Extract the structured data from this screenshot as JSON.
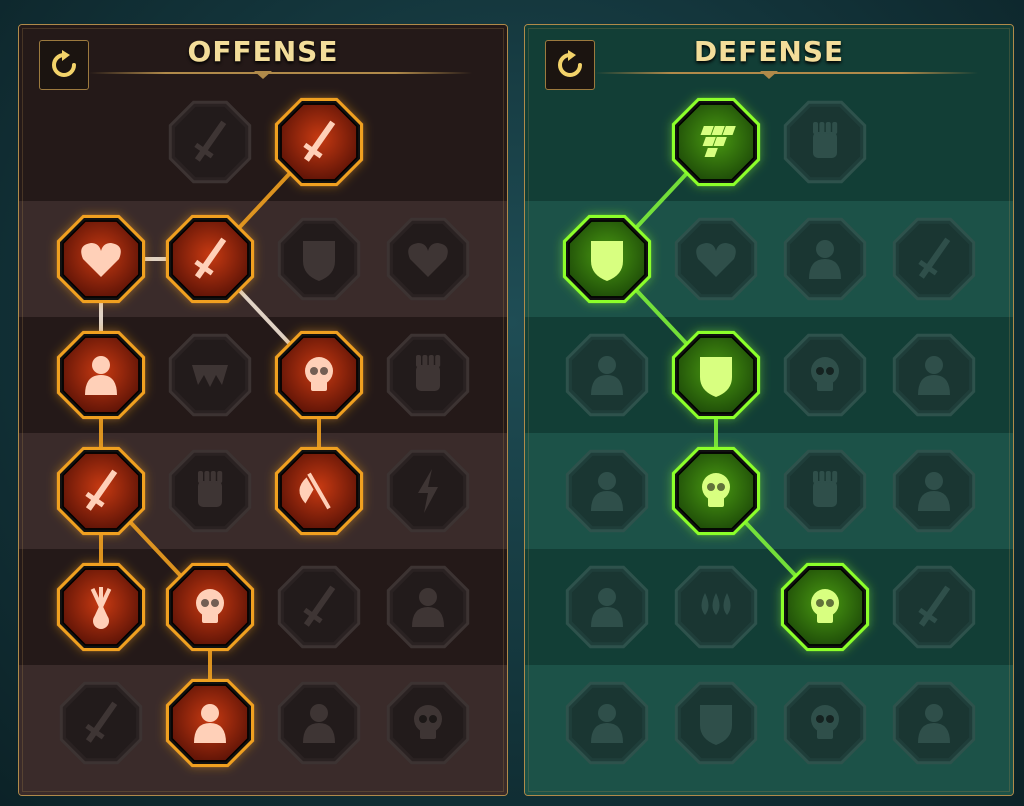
{
  "panels": [
    {
      "id": "offense",
      "title": "OFFENSE",
      "reset_icon": "reset-refresh-icon",
      "colors": {
        "bg_dark": "#241918",
        "bg_light": "#3a2b2a",
        "accent": "#f0a020",
        "active_fill": "#c83a12",
        "active_glyph": "#ffd0b8",
        "line": "#f0a020",
        "line_white": "#f4e6d6"
      },
      "nodes": [
        {
          "id": "o1",
          "name": "crossed-swords-icon",
          "row": 0,
          "col": 1,
          "active": false
        },
        {
          "id": "o2",
          "name": "slash-dagger-icon",
          "row": 0,
          "col": 2,
          "active": true
        },
        {
          "id": "o3",
          "name": "horned-heart-demon-icon",
          "row": 1,
          "col": 0,
          "active": true
        },
        {
          "id": "o4",
          "name": "piercing-spear-icon",
          "row": 1,
          "col": 1,
          "active": true
        },
        {
          "id": "o5",
          "name": "arrow-shield-icon",
          "row": 1,
          "col": 2,
          "active": false
        },
        {
          "id": "o6",
          "name": "thorned-heart-icon",
          "row": 1,
          "col": 3,
          "active": false
        },
        {
          "id": "o7",
          "name": "arrow-pierced-warrior-icon",
          "row": 2,
          "col": 0,
          "active": true
        },
        {
          "id": "o8",
          "name": "fangs-icon",
          "row": 2,
          "col": 1,
          "active": false
        },
        {
          "id": "o9",
          "name": "skull-claw-icon",
          "row": 2,
          "col": 2,
          "active": true
        },
        {
          "id": "o10",
          "name": "scythe-hand-icon",
          "row": 2,
          "col": 3,
          "active": false
        },
        {
          "id": "o11",
          "name": "bleeding-dagger-icon",
          "row": 3,
          "col": 0,
          "active": true
        },
        {
          "id": "o12",
          "name": "fist-strike-icon",
          "row": 3,
          "col": 1,
          "active": false
        },
        {
          "id": "o13",
          "name": "axe-strike-icon",
          "row": 3,
          "col": 2,
          "active": true
        },
        {
          "id": "o14",
          "name": "chain-lightning-icon",
          "row": 3,
          "col": 3,
          "active": false
        },
        {
          "id": "o15",
          "name": "arrow-burst-icon",
          "row": 4,
          "col": 0,
          "active": true
        },
        {
          "id": "o16",
          "name": "triple-skull-icon",
          "row": 4,
          "col": 1,
          "active": true
        },
        {
          "id": "o17",
          "name": "sword-aura-icon",
          "row": 4,
          "col": 2,
          "active": false
        },
        {
          "id": "o18",
          "name": "muscled-warrior-icon",
          "row": 4,
          "col": 3,
          "active": false
        },
        {
          "id": "o19",
          "name": "sparkle-sword-icon",
          "row": 5,
          "col": 0,
          "active": false
        },
        {
          "id": "o20",
          "name": "flaming-helm-icon",
          "row": 5,
          "col": 1,
          "active": true
        },
        {
          "id": "o21",
          "name": "horned-demon-icon",
          "row": 5,
          "col": 2,
          "active": false
        },
        {
          "id": "o22",
          "name": "spiked-skull-icon",
          "row": 5,
          "col": 3,
          "active": false
        }
      ],
      "links": [
        {
          "from": "o2",
          "to": "o4",
          "style": "gold"
        },
        {
          "from": "o3",
          "to": "o4",
          "style": "white"
        },
        {
          "from": "o4",
          "to": "o9",
          "style": "white"
        },
        {
          "from": "o3",
          "to": "o7",
          "style": "white"
        },
        {
          "from": "o7",
          "to": "o11",
          "style": "gold"
        },
        {
          "from": "o9",
          "to": "o13",
          "style": "gold"
        },
        {
          "from": "o11",
          "to": "o15",
          "style": "gold"
        },
        {
          "from": "o11",
          "to": "o16",
          "style": "gold"
        },
        {
          "from": "o16",
          "to": "o20",
          "style": "gold"
        }
      ]
    },
    {
      "id": "defense",
      "title": "DEFENSE",
      "reset_icon": "reset-refresh-icon",
      "colors": {
        "bg_dark": "#123e36",
        "bg_light": "#1c5248",
        "accent": "#8cff2a",
        "active_fill": "#4a9a12",
        "active_glyph": "#d8ff80",
        "line": "#7ef03a",
        "line_white": "#7ef03a"
      },
      "nodes": [
        {
          "id": "d1",
          "name": "stone-blocks-icon",
          "row": 0,
          "col": 1,
          "active": true
        },
        {
          "id": "d2",
          "name": "raised-fist-icon",
          "row": 0,
          "col": 2,
          "active": false
        },
        {
          "id": "d3",
          "name": "layered-shield-icon",
          "row": 1,
          "col": 0,
          "active": true
        },
        {
          "id": "d4",
          "name": "anatomical-heart-icon",
          "row": 1,
          "col": 1,
          "active": false
        },
        {
          "id": "d5",
          "name": "cracked-giant-icon",
          "row": 1,
          "col": 2,
          "active": false
        },
        {
          "id": "d6",
          "name": "deflect-blades-icon",
          "row": 1,
          "col": 3,
          "active": false
        },
        {
          "id": "d7",
          "name": "dodging-warrior-icon",
          "row": 2,
          "col": 0,
          "active": false
        },
        {
          "id": "d8",
          "name": "knight-shield-icon",
          "row": 2,
          "col": 1,
          "active": true
        },
        {
          "id": "d9",
          "name": "skull-heart-icon",
          "row": 2,
          "col": 2,
          "active": false
        },
        {
          "id": "d10",
          "name": "hooded-aura-icon",
          "row": 2,
          "col": 3,
          "active": false
        },
        {
          "id": "d11",
          "name": "crowd-warriors-icon",
          "row": 3,
          "col": 0,
          "active": false
        },
        {
          "id": "d12",
          "name": "skull-hourglass-icon",
          "row": 3,
          "col": 1,
          "active": true
        },
        {
          "id": "d13",
          "name": "open-palm-icon",
          "row": 3,
          "col": 2,
          "active": false
        },
        {
          "id": "d14",
          "name": "bull-head-icon",
          "row": 3,
          "col": 3,
          "active": false
        },
        {
          "id": "d15",
          "name": "running-figure-icon",
          "row": 4,
          "col": 0,
          "active": false
        },
        {
          "id": "d16",
          "name": "blood-drops-icon",
          "row": 4,
          "col": 1,
          "active": false
        },
        {
          "id": "d17",
          "name": "radiant-skull-icon",
          "row": 4,
          "col": 2,
          "active": true
        },
        {
          "id": "d18",
          "name": "sweeping-blade-icon",
          "row": 4,
          "col": 3,
          "active": false
        },
        {
          "id": "d19",
          "name": "defiant-face-icon",
          "row": 5,
          "col": 0,
          "active": false
        },
        {
          "id": "d20",
          "name": "winged-shield-icon",
          "row": 5,
          "col": 1,
          "active": false
        },
        {
          "id": "d21",
          "name": "screaming-skull-icon",
          "row": 5,
          "col": 2,
          "active": false
        },
        {
          "id": "d22",
          "name": "flexing-figure-icon",
          "row": 5,
          "col": 3,
          "active": false
        }
      ],
      "links": [
        {
          "from": "d1",
          "to": "d3",
          "style": "green"
        },
        {
          "from": "d3",
          "to": "d8",
          "style": "green"
        },
        {
          "from": "d8",
          "to": "d12",
          "style": "green"
        },
        {
          "from": "d12",
          "to": "d17",
          "style": "green"
        }
      ]
    }
  ]
}
